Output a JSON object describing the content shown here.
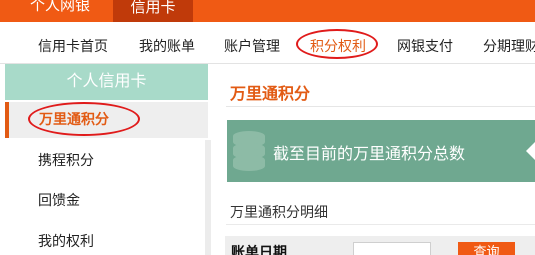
{
  "topbar": {
    "tabs": [
      {
        "label": "个人网银"
      },
      {
        "label": "信用卡"
      }
    ]
  },
  "nav": {
    "items": [
      {
        "label": "信用卡首页"
      },
      {
        "label": "我的账单"
      },
      {
        "label": "账户管理"
      },
      {
        "label": "积分权利"
      },
      {
        "label": "网银支付"
      },
      {
        "label": "分期理财"
      }
    ]
  },
  "sidebar": {
    "title": "个人信用卡",
    "items": [
      {
        "label": "万里通积分"
      },
      {
        "label": "携程积分"
      },
      {
        "label": "回馈金"
      },
      {
        "label": "我的权利"
      }
    ]
  },
  "main": {
    "heading": "万里通积分",
    "banner_text": "截至目前的万里通积分总数",
    "subheading": "万里通积分明细",
    "filter_label": "账单日期",
    "query_button": "查询"
  },
  "colors": {
    "brand": "#f05a14",
    "accent_text": "#e25b14",
    "sidebar_header": "#a8dac9",
    "banner": "#6fa890",
    "annotation_ring": "#e01b1b"
  }
}
